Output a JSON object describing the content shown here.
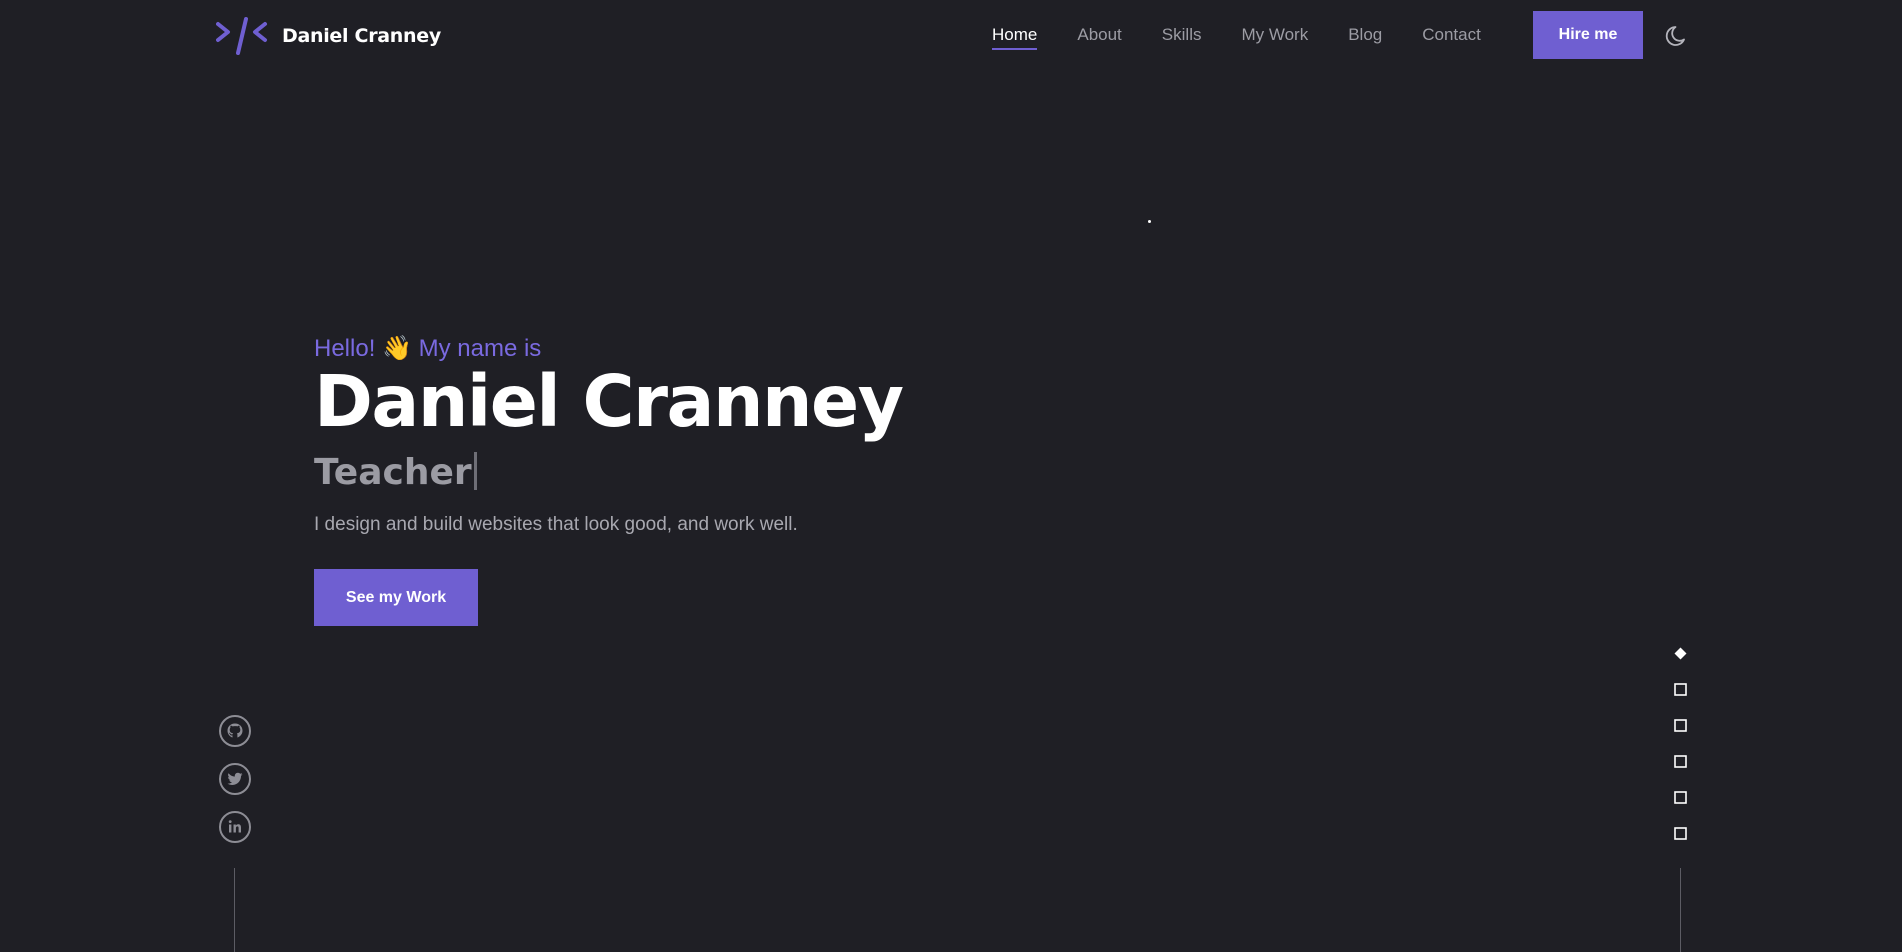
{
  "brand": {
    "name": "Daniel Cranney",
    "logo_icon": "code-slash-logo-icon"
  },
  "nav": {
    "items": [
      "Home",
      "About",
      "Skills",
      "My Work",
      "Blog",
      "Contact"
    ],
    "active": "Home",
    "hire_label": "Hire me",
    "theme_icon": "moon-icon"
  },
  "hero": {
    "greeting_prefix": "Hello!",
    "greeting_emoji": "👋",
    "greeting_suffix": "My name is",
    "name": "Daniel Cranney",
    "role": "Teacher",
    "description": "I design and build websites that look good, and work well.",
    "cta_label": "See my Work"
  },
  "socials": [
    {
      "name": "github",
      "icon": "github-icon"
    },
    {
      "name": "twitter",
      "icon": "twitter-icon"
    },
    {
      "name": "linkedin",
      "icon": "linkedin-icon"
    }
  ],
  "section_indicator": {
    "count": 6,
    "active_index": 0
  },
  "colors": {
    "background": "#1f1f25",
    "accent": "#6f5fd1",
    "text": "#ffffff",
    "muted": "#9c9ca4"
  }
}
